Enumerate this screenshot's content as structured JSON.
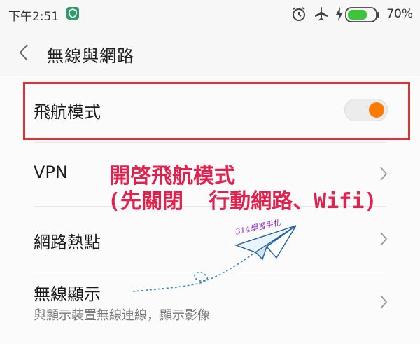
{
  "status_bar": {
    "time": "下午2:51",
    "icons": [
      "shield-icon",
      "alarm-icon",
      "airplane-icon",
      "charging-icon",
      "battery-icon"
    ],
    "battery_percent": "70%",
    "battery_level": 0.7
  },
  "header": {
    "back_icon": "chevron-left-icon",
    "title": "無線與網路"
  },
  "settings": {
    "airplane_mode": {
      "label": "飛航模式",
      "toggle_on": true,
      "accent": "#ff7a00"
    },
    "vpn": {
      "label": "VPN"
    },
    "hotspot": {
      "label": "網路熱點"
    },
    "wireless_display": {
      "label": "無線顯示",
      "subtitle": "與顯示裝置無線連線，顯示影像"
    }
  },
  "annotation": {
    "line1": "開啓飛航模式",
    "line2": "(先關閉  行動網路、Wifi)",
    "color": "#e0224e",
    "box_color": "#d93434"
  },
  "watermark": {
    "text": "314學習手札"
  }
}
